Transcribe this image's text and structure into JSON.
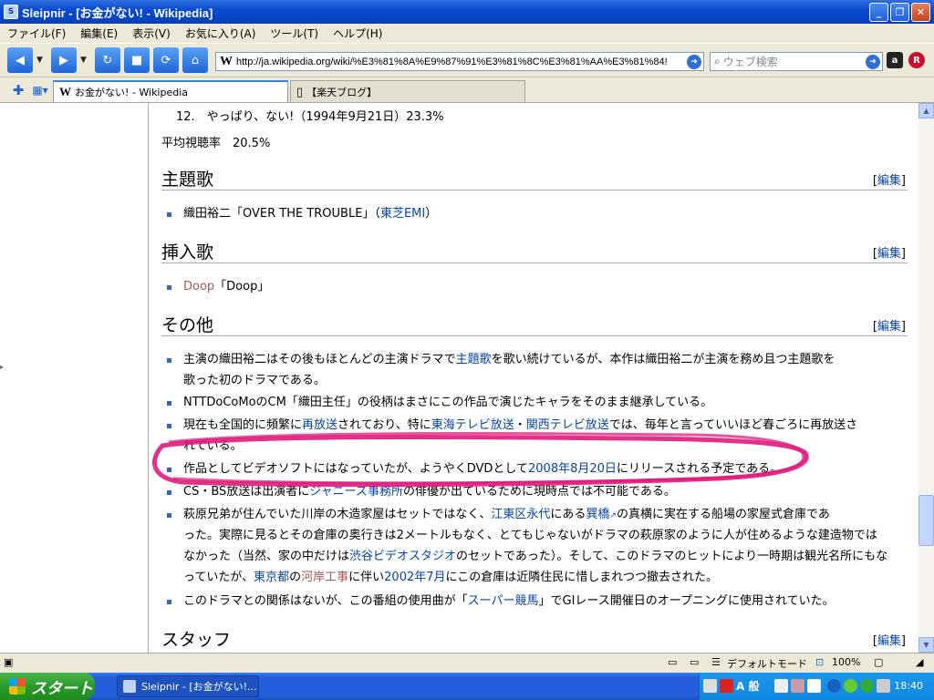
{
  "window": {
    "title": "Sleipnir - [お金がない! - Wikipedia]",
    "minimize_glyph": "_",
    "maximize_glyph": "❐",
    "close_glyph": "✕"
  },
  "menu": [
    "ファイル(F)",
    "編集(E)",
    "表示(V)",
    "お気に入り(A)",
    "ツール(T)",
    "ヘルプ(H)"
  ],
  "toolbar": {
    "address": "http://ja.wikipedia.org/wiki/%E3%81%8A%E9%87%91%E3%81%8C%E3%81%AA%E3%81%84!",
    "address_badge": "W",
    "search_placeholder": "ウェブ検索"
  },
  "tabs": [
    {
      "label": "お金がない! - Wikipedia",
      "icon": "W"
    },
    {
      "label": "【楽天ブログ】",
      "icon": "▯"
    }
  ],
  "article": {
    "rating_item": "12.　やっぱり、ない!（1994年9月21日）23.3%",
    "average": "平均視聴率　20.5%",
    "edit_label": "編集",
    "sections": {
      "theme": "主題歌",
      "insert": "挿入歌",
      "other": "その他",
      "staff": "スタッフ"
    },
    "theme_item": {
      "pre": "織田裕二「OVER THE TROUBLE」（",
      "link": "東芝EMI",
      "post": "）"
    },
    "insert_item": {
      "link": "Doop",
      "post": "「Doop」"
    },
    "other_items": {
      "i1_l1": {
        "pre": "主演の織田裕二はその後もほとんどの主演ドラマで",
        "link": "主題歌",
        "post": "を歌い続けているが、本作は織田裕二が主演を務め且つ主題歌を"
      },
      "i1_l2": "歌った初のドラマである。",
      "i2": "NTTDoCoMoのCM「織田主任」の役柄はまさにこの作品で演じたキャラをそのまま継承している。",
      "i3_l1": {
        "pre": "現在も全国的に頻繁に",
        "link1": "再放送",
        "mid1": "されており、特に",
        "link2": "東海テレビ放送",
        "mid2": "・",
        "link3": "関西テレビ放送",
        "post": "では、毎年と言っていいほど春ごろに再放送さ"
      },
      "i3_l2": "れている。",
      "i4": {
        "pre": "作品としてビデオソフトにはなっていたが、ようやくDVDとして",
        "link": "2008年8月20日",
        "post": "にリリースされる予定である。"
      },
      "i5": {
        "pre": "CS・BS放送は出演者に",
        "link": "ジャニーズ事務所",
        "post": "の俳優が出ているために現時点では不可能である。"
      },
      "i6_l1": {
        "pre": "萩原兄弟が住んでいた川岸の木造家屋はセットではなく、",
        "link1": "江東区",
        "link2": "永代",
        "mid": "にある",
        "link3": "巽橋",
        "post": "の真横に実在する船場の家屋式倉庫であ"
      },
      "i6_l2": "った。実際に見るとその倉庫の奥行きは2メートルもなく、とてもじゃないがドラマの萩原家のように人が住めるような建造物では",
      "i6_l3": {
        "pre": "なかった（当然、家の中だけは",
        "link": "渋谷ビデオスタジオ",
        "post": "のセットであった）。そして、このドラマのヒットにより一時期は観光名所にもな"
      },
      "i6_l4": {
        "pre": "っていたが、",
        "link1": "東京都",
        "mid1": "の",
        "link2": "河岸工事",
        "mid2": "に伴い",
        "link3": "2002年7月",
        "post": "にこの倉庫は近隣住民に惜しまれつつ撤去された。"
      },
      "i7": {
        "pre": "このドラマとの関係はないが、この番組の使用曲が「",
        "link": "スーパー競馬",
        "post": "」でGIレース開催日のオープニングに使用されていた。"
      }
    }
  },
  "status": {
    "mode": "デフォルトモード",
    "zoom": "100%"
  },
  "taskbar": {
    "start": "スタート",
    "task": "Sleipnir - [お金がない!...",
    "clock": "18:40",
    "ime": "A 般"
  },
  "colors": {
    "link": "#0645ad",
    "redlink": "#a55858",
    "annotation": "#e0197d",
    "bullet": "#3366bb"
  }
}
